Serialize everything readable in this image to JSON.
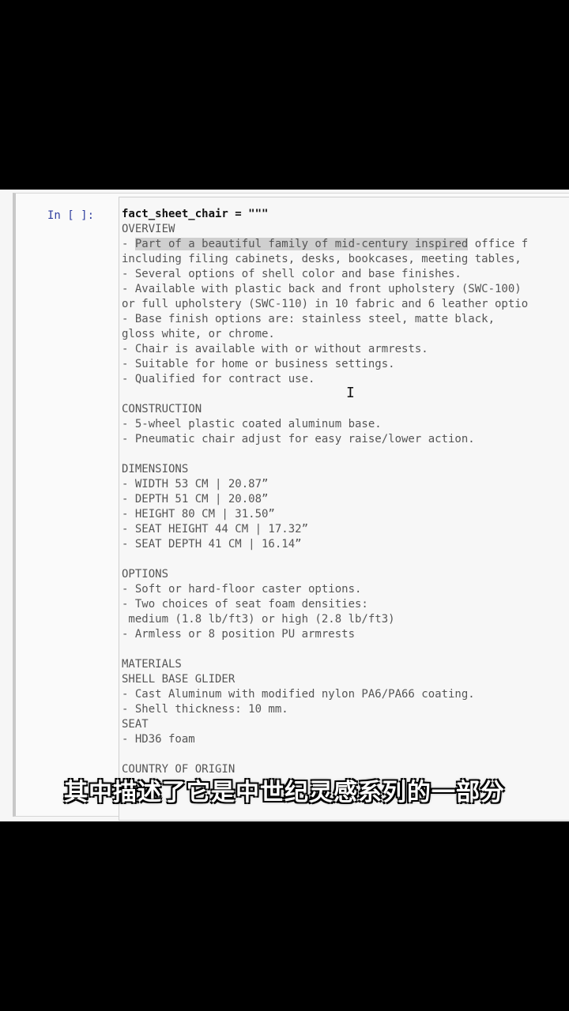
{
  "cell": {
    "prompt": "In [ ]:",
    "lines": [
      "fact_sheet_chair = \"\"\"",
      "OVERVIEW",
      "- Part of a beautiful family of mid-century inspired office f",
      "including filing cabinets, desks, bookcases, meeting tables,",
      "- Several options of shell color and base finishes.",
      "- Available with plastic back and front upholstery (SWC-100)",
      "or full upholstery (SWC-110) in 10 fabric and 6 leather optio",
      "- Base finish options are: stainless steel, matte black,",
      "gloss white, or chrome.",
      "- Chair is available with or without armrests.",
      "- Suitable for home or business settings.",
      "- Qualified for contract use.",
      "",
      "CONSTRUCTION",
      "- 5-wheel plastic coated aluminum base.",
      "- Pneumatic chair adjust for easy raise/lower action.",
      "",
      "DIMENSIONS",
      "- WIDTH 53 CM | 20.87”",
      "- DEPTH 51 CM | 20.08”",
      "- HEIGHT 80 CM | 31.50”",
      "- SEAT HEIGHT 44 CM | 17.32”",
      "- SEAT DEPTH 41 CM | 16.14”",
      "",
      "OPTIONS",
      "- Soft or hard-floor caster options.",
      "- Two choices of seat foam densities:",
      " medium (1.8 lb/ft3) or high (2.8 lb/ft3)",
      "- Armless or 8 position PU armrests",
      "",
      "MATERIALS",
      "SHELL BASE GLIDER",
      "- Cast Aluminum with modified nylon PA6/PA66 coating.",
      "- Shell thickness: 10 mm.",
      "SEAT",
      "- HD36 foam",
      "",
      "COUNTRY OF ORIGIN"
    ],
    "highlight": {
      "line_index": 2,
      "text": "Part of a beautiful family of mid-century inspired"
    }
  },
  "subtitle": "其中描述了它是中世纪灵感系列的一部分",
  "colors": {
    "prompt": "#303f9f",
    "highlight": "#cfcfcf",
    "code_text": "#555555"
  },
  "icons": {
    "cursor": "text-cursor-icon"
  }
}
